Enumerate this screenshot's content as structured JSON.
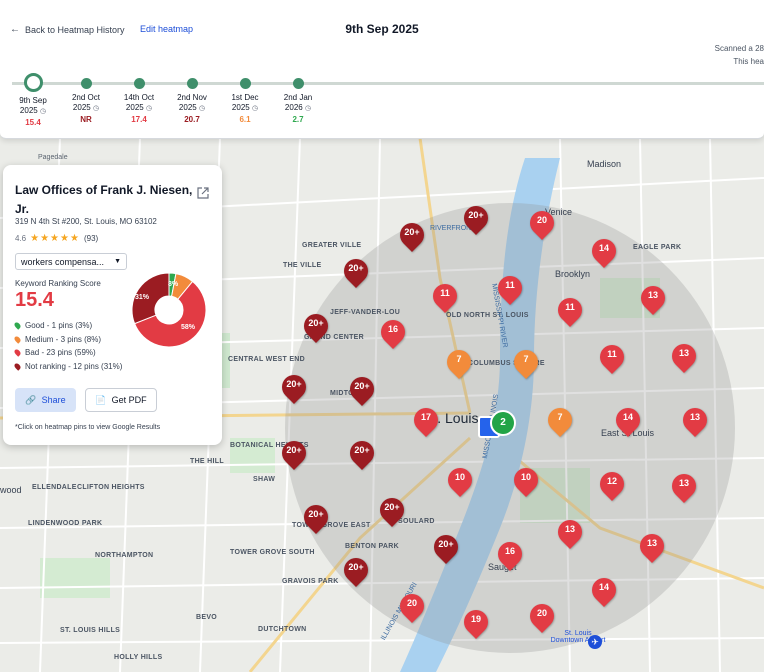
{
  "header": {
    "back_label": "Back to Heatmap History",
    "edit_label": "Edit heatmap",
    "date": "9th Sep 2025",
    "scanned": "Scanned a 28",
    "note": "This hea"
  },
  "timeline": [
    {
      "date": "9th Sep",
      "year": "2025",
      "score": "15.4",
      "color": "#e23b44",
      "active": true
    },
    {
      "date": "2nd Oct",
      "year": "2025",
      "score": "NR",
      "color": "#9b1c22",
      "active": false
    },
    {
      "date": "14th Oct",
      "year": "2025",
      "score": "17.4",
      "color": "#e23b44",
      "active": false
    },
    {
      "date": "2nd Nov",
      "year": "2025",
      "score": "20.7",
      "color": "#9b1c22",
      "active": false
    },
    {
      "date": "1st Dec",
      "year": "2025",
      "score": "6.1",
      "color": "#f28b3b",
      "active": false
    },
    {
      "date": "2nd Jan",
      "year": "2026",
      "score": "2.7",
      "color": "#2fa84f",
      "active": false
    }
  ],
  "business": {
    "name": "Law Offices of Frank J. Niesen, Jr.",
    "address": "319 N 4th St #200, St. Louis, MO 63102",
    "rating": "4.6",
    "stars": "★★★★★",
    "reviews": "(93)",
    "keyword": "workers compensa...",
    "score_label": "Keyword Ranking Score",
    "score": "15.4",
    "legend": [
      {
        "label": "Good - 1 pins (3%)",
        "color": "#2fa84f"
      },
      {
        "label": "Medium - 3 pins (8%)",
        "color": "#f28b3b"
      },
      {
        "label": "Bad - 23 pins (59%)",
        "color": "#e23b44"
      },
      {
        "label": "Not ranking - 12 pins (31%)",
        "color": "#9b1c22"
      }
    ],
    "donut": [
      {
        "label": "3%",
        "value": 3,
        "color": "#2fa84f"
      },
      {
        "label": "8%",
        "value": 8,
        "color": "#f28b3b"
      },
      {
        "label": "58%",
        "value": 58,
        "color": "#e23b44"
      },
      {
        "label": "31%",
        "value": 31,
        "color": "#9b1c22"
      }
    ],
    "share_label": "Share",
    "pdf_label": "Get PDF",
    "hint": "*Click on heatmap pins to view Google Results",
    "pin_count": "2"
  },
  "map": {
    "labels": {
      "pagedale": "Pagedale",
      "madison": "Madison",
      "venice": "Venice",
      "eagle_park": "EAGLE PARK",
      "greater_ville": "GREATER VILLE",
      "the_ville": "THE VILLE",
      "brooklyn": "Brooklyn",
      "jeff_vander_lou": "JEFF-VANDER-LOU",
      "old_north": "OLD NORTH ST. LOUIS",
      "grand_center": "GRAND CENTER",
      "columbus_square": "COLUMBUS SQUARE",
      "central_west_end": "CENTRAL WEST END",
      "midtown": "MIDTOWN",
      "st_louis": "St. Louis",
      "east_st_louis": "East St Louis",
      "botanical_heights": "BOTANICAL HEIGHTS",
      "the_hill": "THE HILL",
      "shaw": "SHAW",
      "ellendale": "ELLENDALE",
      "clifton_heights": "CLIFTON HEIGHTS",
      "tower_grove_east": "TOWER GROVE EAST",
      "soulard": "SOULARD",
      "benton_park": "BENTON PARK",
      "lindenwood_park": "LINDENWOOD PARK",
      "northampton": "NORTHAMPTON",
      "tower_grove_south": "TOWER GROVE SOUTH",
      "gravois_park": "GRAVOIS PARK",
      "bevo": "BEVO",
      "dutchtown": "DUTCHTOWN",
      "st_louis_hills": "ST. LOUIS HILLS",
      "holly_hills": "HOLLY HILLS",
      "sauget": "Sauget",
      "airport": "St. Louis Downtown Airport",
      "wood": "wood",
      "mississippi_river": "MISSISSIPPI RIVER",
      "missouri_illinois": "MISSOURI ILLINOIS",
      "illinois_missouri": "ILLINOIS MISSOURI",
      "riverfront": "RIVERFRONT"
    },
    "pins": [
      {
        "label": "20+",
        "type": "nr"
      },
      {
        "label": "20",
        "type": "bad"
      },
      {
        "label": "20+",
        "type": "nr"
      },
      {
        "label": "14",
        "type": "bad"
      },
      {
        "label": "20+",
        "type": "nr"
      },
      {
        "label": "11",
        "type": "bad"
      },
      {
        "label": "11",
        "type": "bad"
      },
      {
        "label": "11",
        "type": "bad"
      },
      {
        "label": "13",
        "type": "bad"
      },
      {
        "label": "20+",
        "type": "nr"
      },
      {
        "label": "16",
        "type": "bad"
      },
      {
        "label": "7",
        "type": "medium"
      },
      {
        "label": "7",
        "type": "medium"
      },
      {
        "label": "11",
        "type": "bad"
      },
      {
        "label": "13",
        "type": "bad"
      },
      {
        "label": "20+",
        "type": "nr"
      },
      {
        "label": "20+",
        "type": "nr"
      },
      {
        "label": "17",
        "type": "bad"
      },
      {
        "label": "7",
        "type": "medium"
      },
      {
        "label": "14",
        "type": "bad"
      },
      {
        "label": "13",
        "type": "bad"
      },
      {
        "label": "20+",
        "type": "nr"
      },
      {
        "label": "20+",
        "type": "nr"
      },
      {
        "label": "10",
        "type": "bad"
      },
      {
        "label": "10",
        "type": "bad"
      },
      {
        "label": "12",
        "type": "bad"
      },
      {
        "label": "13",
        "type": "bad"
      },
      {
        "label": "20+",
        "type": "nr"
      },
      {
        "label": "20+",
        "type": "nr"
      },
      {
        "label": "20+",
        "type": "nr"
      },
      {
        "label": "13",
        "type": "bad"
      },
      {
        "label": "13",
        "type": "bad"
      },
      {
        "label": "16",
        "type": "bad"
      },
      {
        "label": "20+",
        "type": "nr"
      },
      {
        "label": "20",
        "type": "bad"
      },
      {
        "label": "14",
        "type": "bad"
      },
      {
        "label": "19",
        "type": "bad"
      },
      {
        "label": "20",
        "type": "bad"
      }
    ]
  }
}
